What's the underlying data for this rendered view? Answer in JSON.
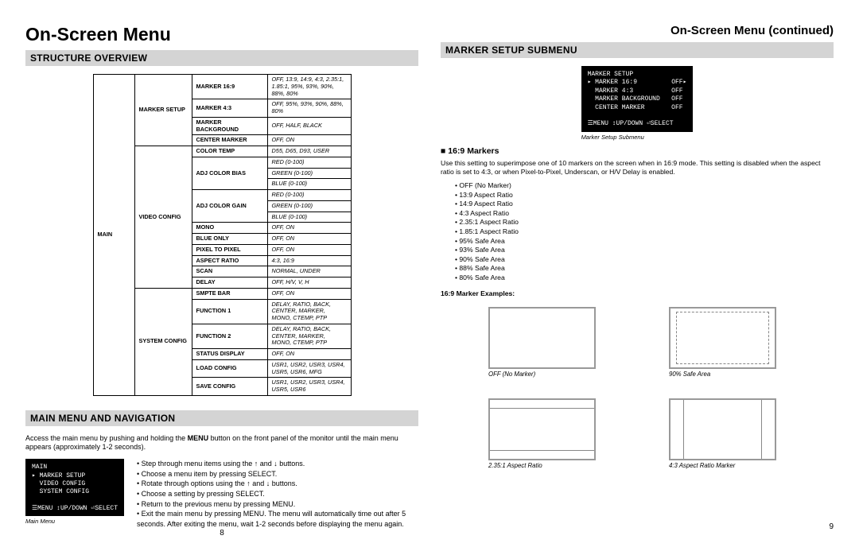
{
  "left": {
    "title": "On-Screen Menu",
    "section1": "STRUCTURE OVERVIEW",
    "table": {
      "main": "MAIN",
      "subs": [
        "MARKER SETUP",
        "VIDEO CONFIG",
        "SYSTEM CONFIG"
      ],
      "rows": [
        [
          "MARKER 16:9",
          "OFF, 13:9, 14:9, 4:3, 2.35:1, 1.85:1, 95%, 93%, 90%, 88%, 80%"
        ],
        [
          "MARKER 4:3",
          "OFF, 95%, 93%, 90%, 88%, 80%"
        ],
        [
          "MARKER BACKGROUND",
          "OFF, HALF, BLACK"
        ],
        [
          "CENTER MARKER",
          "OFF, ON"
        ],
        [
          "COLOR TEMP",
          "D55, D65, D93, USER"
        ],
        [
          "ADJ COLOR BIAS",
          "RED (0-100)"
        ],
        [
          "",
          "GREEN (0-100)"
        ],
        [
          "",
          "BLUE (0-100)"
        ],
        [
          "ADJ COLOR GAIN",
          "RED (0-100)"
        ],
        [
          "",
          "GREEN (0-100)"
        ],
        [
          "",
          "BLUE (0-100)"
        ],
        [
          "MONO",
          "OFF, ON"
        ],
        [
          "BLUE ONLY",
          "OFF, ON"
        ],
        [
          "PIXEL TO PIXEL",
          "OFF, ON"
        ],
        [
          "ASPECT RATIO",
          "4:3, 16:9"
        ],
        [
          "SCAN",
          "NORMAL, UNDER"
        ],
        [
          "DELAY",
          "OFF, H/V, V, H"
        ],
        [
          "SMPTE BAR",
          "OFF, ON"
        ],
        [
          "FUNCTION 1",
          "DELAY, RATIO, BACK, CENTER, MARKER, MONO, CTEMP, PTP"
        ],
        [
          "FUNCTION 2",
          "DELAY, RATIO, BACK, CENTER, MARKER, MONO, CTEMP, PTP"
        ],
        [
          "STATUS DISPLAY",
          "OFF, ON"
        ],
        [
          "LOAD CONFIG",
          "USR1, USR2, USR3, USR4, USR5, USR6, MFG"
        ],
        [
          "SAVE CONFIG",
          "USR1, USR2, USR3, USR4, USR5, USR6"
        ]
      ]
    },
    "section2": "MAIN MENU AND NAVIGATION",
    "nav_intro_1": "Access the main menu by pushing and holding the ",
    "nav_intro_menu": "MENU",
    "nav_intro_2": " button on the front panel of the monitor until the main menu appears (approximately 1-2 seconds).",
    "screenshot": {
      "line1": "MAIN",
      "line2": "▸ MARKER SETUP",
      "line3": "  VIDEO CONFIG",
      "line4": "  SYSTEM CONFIG",
      "line5": "",
      "line6": "☰MENU ↕UP/DOWN ⏎SELECT"
    },
    "screenshot_caption": "Main Menu",
    "nav_items": [
      "Step through menu items using the ↑ and ↓ buttons.",
      "Choose a menu item by pressing SELECT.",
      "Rotate through options using the ↑ and ↓ buttons.",
      "Choose a setting by pressing SELECT.",
      "Return to the previous menu by pressing MENU.",
      "Exit the main menu by pressing MENU. The menu will automatically time out after 5 seconds. After exiting the menu, wait 1-2 seconds before displaying the menu again."
    ],
    "page": "8"
  },
  "right": {
    "title": "On-Screen Menu (continued)",
    "section": "MARKER SETUP SUBMENU",
    "screenshot": {
      "line1": "MARKER SETUP",
      "line2": "▸ MARKER 16:9         OFF▸",
      "line3": "  MARKER 4:3          OFF",
      "line4": "  MARKER BACKGROUND   OFF",
      "line5": "  CENTER MARKER       OFF",
      "line6": "",
      "line7": "☰MENU ↕UP/DOWN ⏎SELECT"
    },
    "screenshot_caption": "Marker Setup Submenu",
    "subhead": "■  16:9 Markers",
    "desc": "Use this setting to superimpose one of 10 markers on the screen when in 16:9 mode. This setting is disabled when the aspect ratio is set to 4:3, or when Pixel-to-Pixel, Underscan, or H/V Delay is enabled.",
    "list": [
      "OFF (No Marker)",
      "13:9 Aspect Ratio",
      "14:9 Aspect Ratio",
      "4:3 Aspect Ratio",
      "2.35:1 Aspect Ratio",
      "1.85:1 Aspect Ratio",
      "95% Safe Area",
      "93% Safe Area",
      "90% Safe Area",
      "88% Safe Area",
      "80% Safe Area"
    ],
    "ex_label": "16:9 Marker Examples:",
    "captions": {
      "off": "OFF (No Marker)",
      "safe90": "90% Safe Area",
      "ar235": "2.35:1 Aspect Ratio",
      "ar43": "4:3 Aspect Ratio Marker"
    },
    "page": "9"
  }
}
